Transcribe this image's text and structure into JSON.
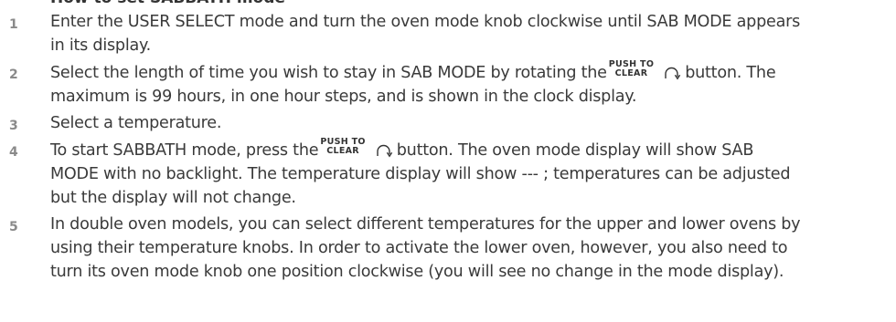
{
  "heading": "How to set SABBATH mode",
  "button_label": {
    "top": "PUSH TO",
    "bottom": "CLEAR"
  },
  "icons": {
    "button_arc": "rotate-arc-icon"
  },
  "steps": [
    {
      "number": "1",
      "lines": [
        "Enter the USER SELECT mode and turn the oven mode knob clockwise until SAB MODE appears",
        "in its display."
      ]
    },
    {
      "number": "2",
      "line1_before": "Select the length of time you wish to stay in SAB MODE by rotating the",
      "line1_after": "button. The",
      "line2": "maximum is 99 hours, in one hour steps, and is shown in the clock display."
    },
    {
      "number": "3",
      "lines": [
        "Select a temperature."
      ]
    },
    {
      "number": "4",
      "line1_before": "To start SABBATH mode, press the",
      "line1_after": "button. The oven mode display will show SAB",
      "line2": "MODE with no backlight. The temperature display will show  --- ; temperatures can be adjusted",
      "line3": "but the display will not change."
    },
    {
      "number": "5",
      "lines": [
        "In double oven models, you can select different temperatures for the upper and lower ovens by",
        "using their temperature knobs. In order to activate the lower oven, however, you also need to",
        "turn its oven mode knob one position clockwise (you will see no change in the mode display)."
      ]
    }
  ]
}
